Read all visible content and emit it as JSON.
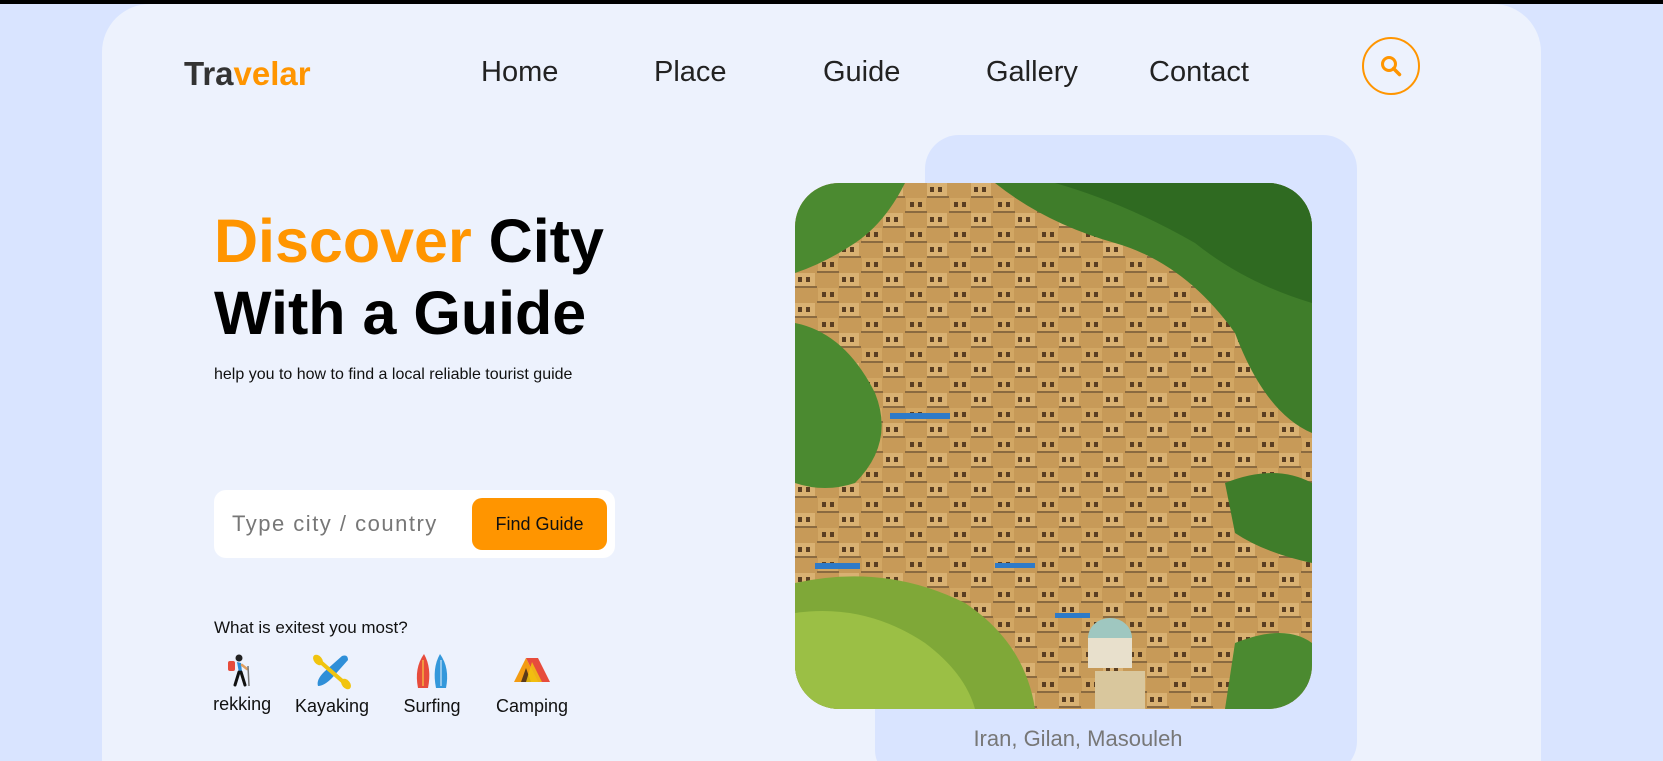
{
  "brand": {
    "part1": "Tra",
    "part2": "velar"
  },
  "nav": {
    "items": [
      {
        "label": "Home"
      },
      {
        "label": "Place"
      },
      {
        "label": "Guide"
      },
      {
        "label": "Gallery"
      },
      {
        "label": "Contact"
      }
    ],
    "search_icon": "search-icon"
  },
  "hero": {
    "title_accent": "Discover",
    "title_rest1": "City",
    "title_line2": "With a Guide",
    "subtitle": "help you to how to find a local reliable tourist guide"
  },
  "search": {
    "placeholder": "Type city / country",
    "value": "",
    "button_label": "Find Guide"
  },
  "interests": {
    "question": "What is exitest you most?",
    "items": [
      {
        "label": "Trekking",
        "icon": "hiker-icon"
      },
      {
        "label": "Kayaking",
        "icon": "kayak-icon"
      },
      {
        "label": "Surfing",
        "icon": "surfboard-icon"
      },
      {
        "label": "Camping",
        "icon": "tent-icon"
      }
    ]
  },
  "photo": {
    "caption": "Iran, Gilan, Masouleh"
  },
  "colors": {
    "accent": "#ff9500",
    "background": "#d9e4ff",
    "card": "#edf2fd"
  }
}
